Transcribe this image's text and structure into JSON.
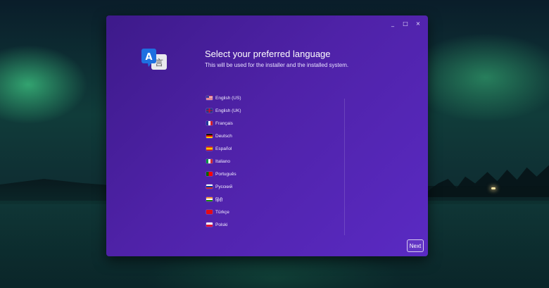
{
  "window": {
    "controls": [
      "_",
      "□",
      "×"
    ]
  },
  "app_icon": {
    "name": "language-translate-icon",
    "letter": "A",
    "glyph": "言"
  },
  "header": {
    "title": "Select your preferred language",
    "subtitle": "This will be used for the installer and the installed system."
  },
  "languages": [
    {
      "label": "English (US)",
      "flag": "us-flag-icon"
    },
    {
      "label": "English (UK)",
      "flag": "uk-flag-icon"
    },
    {
      "label": "Français",
      "flag": "france-flag-icon"
    },
    {
      "label": "Deutsch",
      "flag": "germany-flag-icon"
    },
    {
      "label": "Español",
      "flag": "spain-flag-icon"
    },
    {
      "label": "Italiano",
      "flag": "italy-flag-icon"
    },
    {
      "label": "Português",
      "flag": "portugal-flag-icon"
    },
    {
      "label": "Русский",
      "flag": "russia-flag-icon"
    },
    {
      "label": "हिंदी",
      "flag": "india-flag-icon"
    },
    {
      "label": "Türkçe",
      "flag": "turkey-flag-icon"
    },
    {
      "label": "Polski",
      "flag": "poland-flag-icon"
    }
  ],
  "footer": {
    "next_label": "Next"
  },
  "colors": {
    "window_gradient_start": "#3d1a8a",
    "window_gradient_end": "#5a2ac3",
    "icon_blue": "#1e6fe0"
  }
}
